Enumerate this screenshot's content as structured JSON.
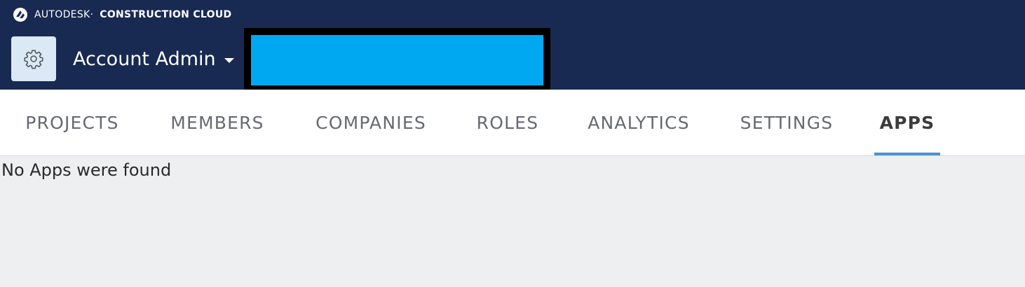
{
  "brand": {
    "text_regular": "AUTODESK·",
    "text_bold": "CONSTRUCTION CLOUD"
  },
  "header": {
    "app_title": "Account Admin"
  },
  "tabs": [
    {
      "label": "PROJECTS",
      "active": false
    },
    {
      "label": "MEMBERS",
      "active": false
    },
    {
      "label": "COMPANIES",
      "active": false
    },
    {
      "label": "ROLES",
      "active": false
    },
    {
      "label": "ANALYTICS",
      "active": false
    },
    {
      "label": "SETTINGS",
      "active": false
    },
    {
      "label": "APPS",
      "active": true
    }
  ],
  "content": {
    "empty_message": "No Apps were found"
  },
  "colors": {
    "header_bg": "#182a52",
    "accent_underline": "#4b91cf",
    "redaction_fill": "#00a8f2"
  },
  "icons": {
    "brand": "autodesk-logo-icon",
    "settings": "gear-icon",
    "dropdown": "caret-down-icon"
  }
}
